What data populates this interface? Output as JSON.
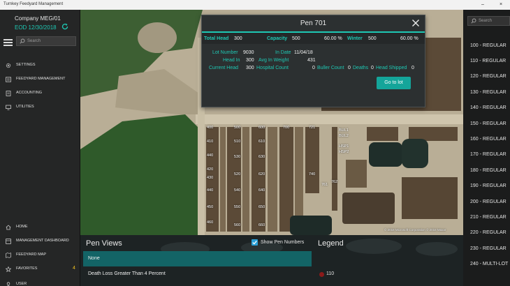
{
  "window": {
    "title": "Turnkey Feedyard Management",
    "minimize": "–",
    "close": "×"
  },
  "nav": {
    "company": "Company MEG/01",
    "eod": "EOD 12/30/2018",
    "search_placeholder": "Search",
    "items_top": [
      "SETTINGS",
      "FEEDYARD MANAGEMENT",
      "ACCOUNTING",
      "UTILITIES"
    ],
    "items_bottom": [
      "HOME",
      "MANAGEMENT DASHBOARD",
      "FEEDYARD MAP",
      "FAVORITES",
      "USER"
    ],
    "favorites_count": "4"
  },
  "right_panel": {
    "search_placeholder": "Search",
    "pens": [
      "100 - REGULAR",
      "110 - REGULAR",
      "120 - REGULAR",
      "130 - REGULAR",
      "140 - REGULAR",
      "150 - REGULAR",
      "160 - REGULAR",
      "170 - REGULAR",
      "180 - REGULAR",
      "190 - REGULAR",
      "200 - REGULAR",
      "210 - REGULAR",
      "220 - REGULAR",
      "230 - REGULAR",
      "240 - MULTI-LOT"
    ]
  },
  "map": {
    "labels": [
      "400",
      "500",
      "600",
      "700",
      "721",
      "410",
      "510",
      "610",
      "440",
      "420",
      "520",
      "620",
      "430",
      "530",
      "630",
      "740",
      "440",
      "540",
      "640",
      "450",
      "550",
      "650",
      "460",
      "560",
      "660",
      "BUL1",
      "BUL2",
      "HSP1",
      "HSP2",
      "761",
      "762"
    ],
    "attribution": "© 2018 Microsoft Corporation © 2018 Maxar"
  },
  "popup": {
    "title": "Pen 701",
    "stats": {
      "total_head_label": "Total Head",
      "total_head": "300",
      "capacity_label": "Capacity",
      "capacity": "500",
      "capacity_pct": "60.00 %",
      "winter_label": "Winter",
      "winter": "500",
      "winter_pct": "60.00 %"
    },
    "details": {
      "lot_number_label": "Lot Number",
      "lot_number": "9030",
      "in_date_label": "In Date",
      "in_date": "11/04/18",
      "head_in_label": "Head In",
      "head_in": "300",
      "avg_in_weight_label": "Avg In Weight",
      "avg_in_weight": "431",
      "current_head_label": "Current Head",
      "current_head": "300",
      "hospital_count_label": "Hospital Count",
      "hospital_count": "0",
      "buller_count_label": "Buller Count",
      "buller_count": "0",
      "deaths_label": "Deaths",
      "deaths": "0",
      "head_shipped_label": "Head Shipped",
      "head_shipped": "0"
    },
    "go_to_lot": "Go to lot",
    "accent_color": "#1ec8b4"
  },
  "pen_views": {
    "title": "Pen Views",
    "show_pen_numbers_label": "Show Pen Numbers",
    "show_pen_numbers": true,
    "items": [
      "None",
      "Death Loss Greater Than 4 Percent"
    ],
    "selected": "None"
  },
  "legend": {
    "title": "Legend",
    "items": [
      {
        "label": "110",
        "color": "#8b1a1a"
      }
    ]
  }
}
